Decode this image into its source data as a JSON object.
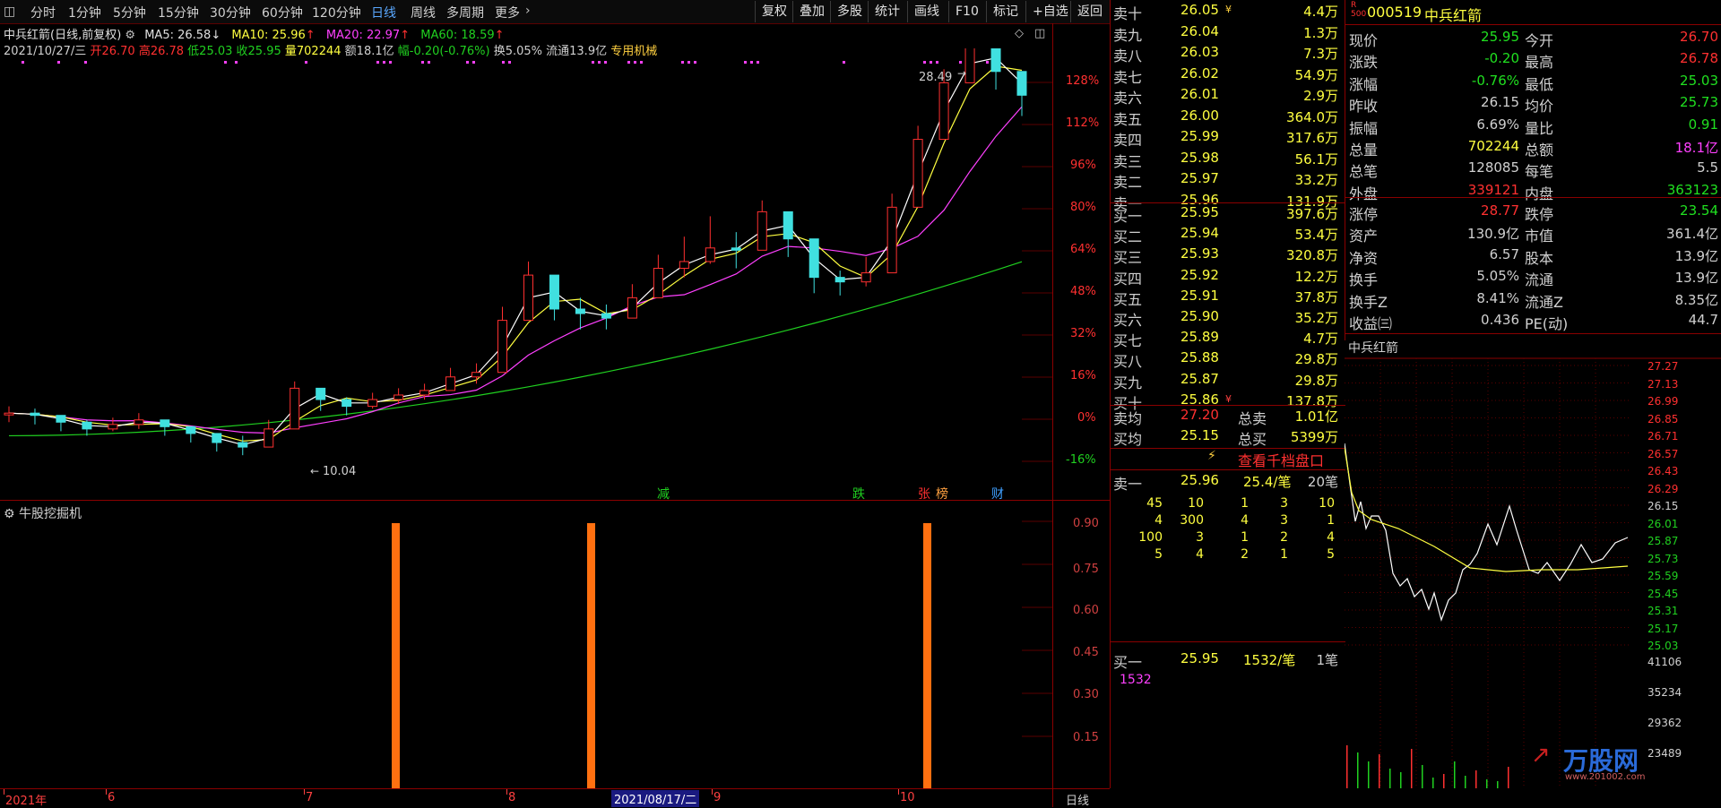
{
  "toolbar": {
    "periods": [
      "分时",
      "1分钟",
      "5分钟",
      "15分钟",
      "30分钟",
      "60分钟",
      "120分钟",
      "日线",
      "周线",
      "多周期",
      "更多"
    ],
    "active": "日线",
    "buttons": [
      "复权",
      "叠加",
      "多股",
      "统计",
      "画线",
      "F10",
      "标记",
      "+自选",
      "返回"
    ]
  },
  "chart_title": "中兵红箭(日线,前复权)",
  "ma": {
    "ma5": "MA5: 26.58",
    "ma10": "MA10: 25.96",
    "ma20": "MA20: 22.97",
    "ma60": "MA60: 18.59"
  },
  "day_info": {
    "date": "2021/10/27/三",
    "open": "开26.70",
    "high": "高26.78",
    "low": "低25.03",
    "close": "收25.95",
    "volume": "量702244",
    "amount": "额18.1亿",
    "change": "幅-0.20(-0.76%)",
    "turnover": "换5.05%",
    "float": "流通13.9亿",
    "sector": "专用机械"
  },
  "annotations": {
    "max_label": "28.49",
    "min_label": "10.04"
  },
  "event_markers": [
    "减",
    "跌",
    "张",
    "榜",
    "财"
  ],
  "indicator_name": "牛股挖掘机",
  "price_axis": [
    "128%",
    "112%",
    "96%",
    "80%",
    "64%",
    "48%",
    "32%",
    "16%",
    "0%",
    "-16%"
  ],
  "indicator_axis": [
    "0.90",
    "0.75",
    "0.60",
    "0.45",
    "0.30",
    "0.15"
  ],
  "date_axis": [
    "2021年",
    "6",
    "7",
    "8",
    "2021/08/17/二",
    "9",
    "10"
  ],
  "period_label": "日线",
  "orderbook": {
    "asks": [
      {
        "label": "卖十",
        "price": "26.05",
        "vol": "4.4万",
        "mark": "¥"
      },
      {
        "label": "卖九",
        "price": "26.04",
        "vol": "1.3万"
      },
      {
        "label": "卖八",
        "price": "26.03",
        "vol": "7.3万"
      },
      {
        "label": "卖七",
        "price": "26.02",
        "vol": "54.9万"
      },
      {
        "label": "卖六",
        "price": "26.01",
        "vol": "2.9万"
      },
      {
        "label": "卖五",
        "price": "26.00",
        "vol": "364.0万"
      },
      {
        "label": "卖四",
        "price": "25.99",
        "vol": "317.6万"
      },
      {
        "label": "卖三",
        "price": "25.98",
        "vol": "56.1万"
      },
      {
        "label": "卖二",
        "price": "25.97",
        "vol": "33.2万"
      },
      {
        "label": "卖一",
        "price": "25.96",
        "vol": "131.9万"
      }
    ],
    "bids": [
      {
        "label": "买一",
        "price": "25.95",
        "vol": "397.6万"
      },
      {
        "label": "买二",
        "price": "25.94",
        "vol": "53.4万"
      },
      {
        "label": "买三",
        "price": "25.93",
        "vol": "320.8万"
      },
      {
        "label": "买四",
        "price": "25.92",
        "vol": "12.2万"
      },
      {
        "label": "买五",
        "price": "25.91",
        "vol": "37.8万"
      },
      {
        "label": "买六",
        "price": "25.90",
        "vol": "35.2万"
      },
      {
        "label": "买七",
        "price": "25.89",
        "vol": "4.7万"
      },
      {
        "label": "买八",
        "price": "25.88",
        "vol": "29.8万"
      },
      {
        "label": "买九",
        "price": "25.87",
        "vol": "29.8万"
      },
      {
        "label": "买十",
        "price": "25.86",
        "vol": "137.8万",
        "mark": "¥"
      }
    ],
    "avg": [
      {
        "l1": "卖均",
        "v1": "27.20",
        "l2": "总卖",
        "v2": "1.01亿"
      },
      {
        "l1": "买均",
        "v1": "25.15",
        "l2": "总买",
        "v2": "5399万"
      }
    ],
    "detail_button": "查看千档盘口",
    "ask1_queue": {
      "label": "卖一",
      "price": "25.96",
      "per": "25.4/笔",
      "count": "20笔",
      "rows": [
        [
          "45",
          "10",
          "1",
          "3",
          "10"
        ],
        [
          "4",
          "300",
          "4",
          "3",
          "1"
        ],
        [
          "100",
          "3",
          "1",
          "2",
          "4"
        ],
        [
          "5",
          "4",
          "2",
          "1",
          "5"
        ]
      ]
    },
    "bid1_queue": {
      "label": "买一",
      "price": "25.95",
      "per": "1532/笔",
      "count": "1笔",
      "rows": [
        [
          "1532"
        ]
      ]
    }
  },
  "quote": {
    "badge_top": "R",
    "badge_bottom": "500",
    "code": "000519",
    "name": "中兵红箭",
    "rows": [
      {
        "l1": "现价",
        "v1": "25.95",
        "c1": "#20e020",
        "l2": "今开",
        "v2": "26.70",
        "c2": "#ff3030"
      },
      {
        "l1": "涨跌",
        "v1": "-0.20",
        "c1": "#20e020",
        "l2": "最高",
        "v2": "26.78",
        "c2": "#ff3030"
      },
      {
        "l1": "涨幅",
        "v1": "-0.76%",
        "c1": "#20e020",
        "l2": "最低",
        "v2": "25.03",
        "c2": "#20e020"
      },
      {
        "l1": "昨收",
        "v1": "26.15",
        "c1": "#d0d0d0",
        "l2": "均价",
        "v2": "25.73",
        "c2": "#20e020"
      },
      {
        "l1": "振幅",
        "v1": "6.69%",
        "c1": "#d0d0d0",
        "l2": "量比",
        "v2": "0.91",
        "c2": "#20e020"
      },
      {
        "l1": "总量",
        "v1": "702244",
        "c1": "#ffff40",
        "l2": "总额",
        "v2": "18.1亿",
        "c2": "#ff40ff"
      },
      {
        "l1": "总笔",
        "v1": "128085",
        "c1": "#d0d0d0",
        "l2": "每笔",
        "v2": "5.5",
        "c2": "#d0d0d0"
      },
      {
        "l1": "外盘",
        "v1": "339121",
        "c1": "#ff3030",
        "l2": "内盘",
        "v2": "363123",
        "c2": "#20e020"
      }
    ],
    "rows2": [
      {
        "l1": "涨停",
        "v1": "28.77",
        "c1": "#ff3030",
        "l2": "跌停",
        "v2": "23.54",
        "c2": "#20e020"
      },
      {
        "l1": "资产",
        "v1": "130.9亿",
        "c1": "#d0d0d0",
        "l2": "市值",
        "v2": "361.4亿",
        "c2": "#d0d0d0"
      },
      {
        "l1": "净资",
        "v1": "6.57",
        "c1": "#d0d0d0",
        "l2": "股本",
        "v2": "13.9亿",
        "c2": "#d0d0d0"
      },
      {
        "l1": "换手",
        "v1": "5.05%",
        "c1": "#d0d0d0",
        "l2": "流通",
        "v2": "13.9亿",
        "c2": "#d0d0d0"
      },
      {
        "l1": "换手Z",
        "v1": "8.41%",
        "c1": "#d0d0d0",
        "l2": "流通Z",
        "v2": "8.35亿",
        "c2": "#d0d0d0"
      },
      {
        "l1": "收益㈢",
        "v1": "0.436",
        "c1": "#d0d0d0",
        "l2": "PE(动)",
        "v2": "44.7",
        "c2": "#d0d0d0"
      }
    ]
  },
  "mini": {
    "title": "中兵红箭",
    "price_labels": [
      "27.27",
      "27.13",
      "26.99",
      "26.85",
      "26.71",
      "26.57",
      "26.43",
      "26.29",
      "26.15",
      "26.01",
      "25.87",
      "25.73",
      "25.59",
      "25.45",
      "25.31",
      "25.17",
      "25.03"
    ],
    "vol_labels": [
      "41106",
      "35234",
      "29362",
      "23489"
    ]
  },
  "watermark": {
    "text": "万股网",
    "sub": "www.201002.com"
  },
  "chart_data": {
    "type": "candlestick",
    "x": [
      "2021/05/06",
      "2021/05/11",
      "2021/05/14",
      "2021/05/19",
      "2021/05/24",
      "2021/05/27",
      "2021/06/01",
      "2021/06/04",
      "2021/06/09",
      "2021/06/15",
      "2021/06/18",
      "2021/06/23",
      "2021/06/28",
      "2021/07/01",
      "2021/07/06",
      "2021/07/09",
      "2021/07/14",
      "2021/07/19",
      "2021/07/22",
      "2021/07/27",
      "2021/07/30",
      "2021/08/04",
      "2021/08/09",
      "2021/08/12",
      "2021/08/17",
      "2021/08/20",
      "2021/08/25",
      "2021/08/30",
      "2021/09/02",
      "2021/09/07",
      "2021/09/10",
      "2021/09/15",
      "2021/09/22",
      "2021/09/27",
      "2021/09/30",
      "2021/10/12",
      "2021/10/15",
      "2021/10/20",
      "2021/10/25",
      "2021/10/27"
    ],
    "close": [
      11.9,
      11.8,
      11.5,
      11.2,
      11.4,
      11.6,
      11.3,
      11.0,
      10.6,
      10.4,
      11.2,
      13.0,
      12.5,
      12.2,
      12.5,
      12.7,
      12.9,
      13.5,
      13.7,
      16.0,
      18.0,
      16.5,
      16.3,
      16.1,
      17.0,
      18.3,
      18.6,
      19.2,
      19.1,
      20.8,
      19.6,
      17.9,
      17.7,
      18.1,
      21.0,
      24.0,
      26.5,
      28.2,
      27.0,
      25.95
    ],
    "high": [
      12.2,
      12.1,
      11.8,
      11.6,
      11.7,
      11.9,
      11.6,
      11.3,
      11.0,
      10.9,
      11.6,
      13.3,
      12.9,
      12.6,
      12.8,
      13.0,
      13.2,
      13.9,
      14.1,
      16.6,
      18.6,
      17.6,
      17.0,
      16.7,
      17.6,
      18.9,
      19.7,
      20.6,
      19.9,
      21.3,
      20.3,
      18.6,
      18.2,
      18.8,
      21.6,
      24.6,
      27.1,
      28.49,
      27.8,
      26.78
    ],
    "low": [
      11.5,
      11.4,
      11.1,
      10.9,
      11.1,
      11.2,
      10.9,
      10.6,
      10.2,
      10.04,
      10.5,
      12.3,
      12.0,
      11.8,
      12.1,
      12.3,
      12.5,
      13.0,
      13.2,
      14.4,
      16.3,
      16.0,
      15.6,
      15.6,
      16.4,
      17.6,
      17.9,
      18.5,
      18.3,
      19.5,
      18.8,
      17.2,
      17.1,
      17.5,
      19.8,
      22.5,
      25.6,
      26.8,
      26.2,
      25.03
    ],
    "ma5": "26.58",
    "ma10": "25.96",
    "ma20": "22.97",
    "ma60": "18.59",
    "signal_dates": [
      "2021/07/12",
      "2021/08/12",
      "2021/10/13"
    ],
    "signal_value": 0.9
  }
}
